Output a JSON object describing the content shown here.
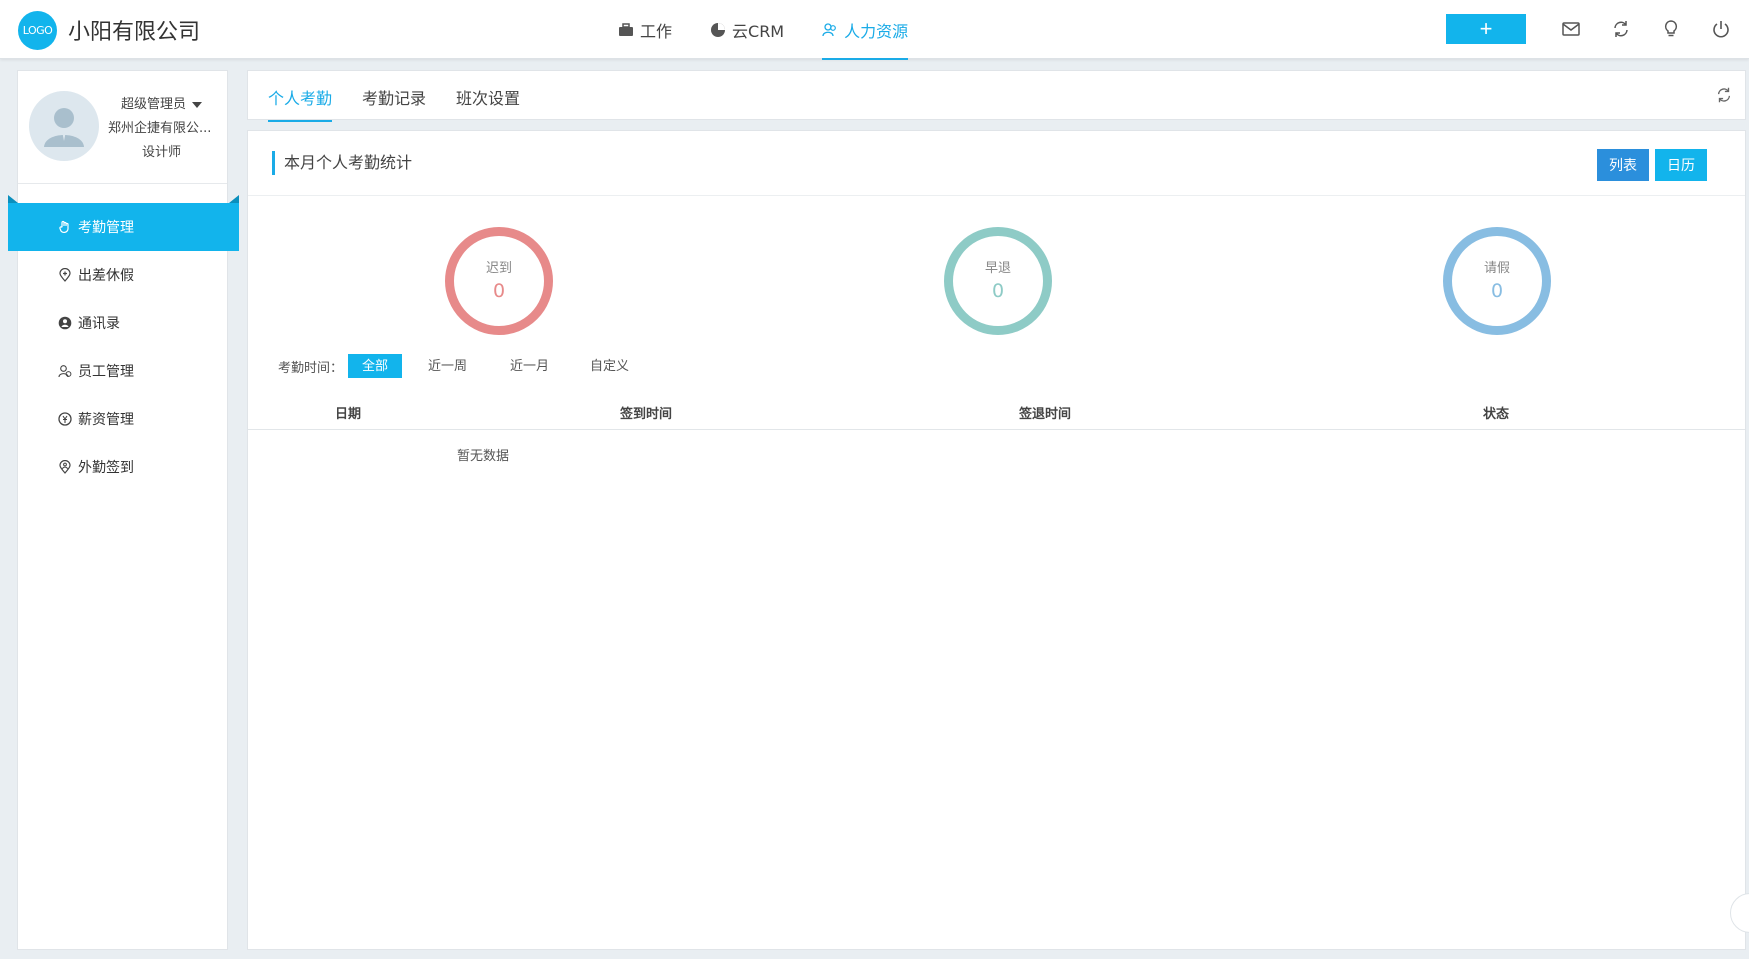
{
  "app": {
    "logo_text": "LOGO",
    "company_name": "小阳有限公司"
  },
  "nav": {
    "items": [
      {
        "label": "工作",
        "icon": "briefcase-icon"
      },
      {
        "label": "云CRM",
        "icon": "pie-chart-icon"
      },
      {
        "label": "人力资源",
        "icon": "people-icon",
        "active": true
      }
    ]
  },
  "toolbar": {
    "add_label": "+",
    "icons": [
      "mail-icon",
      "refresh-icon",
      "lightbulb-icon",
      "power-icon"
    ]
  },
  "user": {
    "role": "超级管理员",
    "company": "郑州企捷有限公...",
    "title": "设计师"
  },
  "sidebar": {
    "items": [
      {
        "label": "考勤管理",
        "icon": "hand-icon",
        "active": true
      },
      {
        "label": "出差休假",
        "icon": "location-plus-icon"
      },
      {
        "label": "通讯录",
        "icon": "contact-icon"
      },
      {
        "label": "员工管理",
        "icon": "staff-icon"
      },
      {
        "label": "薪资管理",
        "icon": "salary-icon"
      },
      {
        "label": "外勤签到",
        "icon": "pin-icon"
      }
    ]
  },
  "tabs": [
    {
      "label": "个人考勤",
      "active": true
    },
    {
      "label": "考勤记录"
    },
    {
      "label": "班次设置"
    }
  ],
  "main": {
    "section_title": "本月个人考勤统计",
    "view_list": "列表",
    "view_calendar": "日历",
    "stats": [
      {
        "label": "迟到",
        "value": "0",
        "color": "#e78a8a"
      },
      {
        "label": "早退",
        "value": "0",
        "color": "#8ecbc6"
      },
      {
        "label": "请假",
        "value": "0",
        "color": "#88bde2"
      }
    ],
    "filter_label": "考勤时间：",
    "filters": [
      "全部",
      "近一周",
      "近一月",
      "自定义"
    ],
    "columns": [
      "日期",
      "签到时间",
      "签退时间",
      "状态"
    ],
    "empty_text": "暂无数据"
  },
  "colors": {
    "accent": "#12b4ec",
    "list_button": "#2b8fdc",
    "calendar_button": "#12b4ec"
  }
}
